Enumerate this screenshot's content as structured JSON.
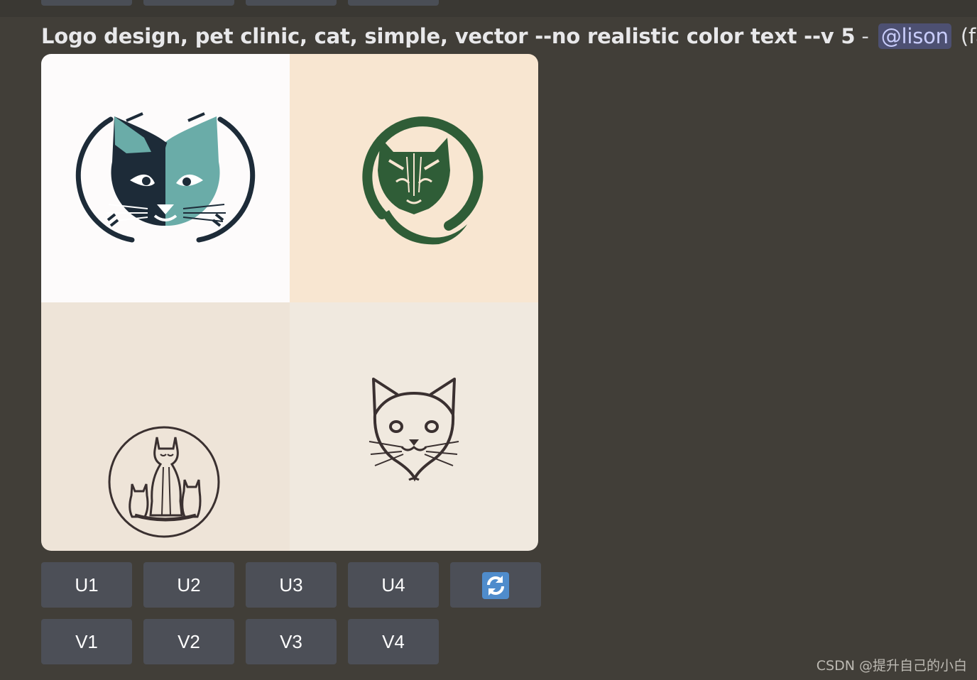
{
  "message": {
    "prompt": "Logo design, pet clinic, cat, simple, vector --no realistic color text --v 5",
    "separator": "-",
    "mention": "@lison",
    "speed": "(fast)"
  },
  "image_grid": {
    "tiles": [
      {
        "icon": "teal-cat-face-logo"
      },
      {
        "icon": "green-circle-cat-logo"
      },
      {
        "icon": "cat-family-circle-logo"
      },
      {
        "icon": "line-cat-face-logo"
      }
    ]
  },
  "buttons": {
    "upscale": [
      "U1",
      "U2",
      "U3",
      "U4"
    ],
    "variation": [
      "V1",
      "V2",
      "V3",
      "V4"
    ],
    "reroll_icon": "arrows-counterclockwise-icon"
  },
  "colors": {
    "background": "#413e38",
    "button": "#4c4f57",
    "mention_bg": "#4d5072",
    "mention_text": "#c9cdfb",
    "reroll_blue": "#4f8ccc"
  },
  "watermark": "CSDN @提升自己的小白"
}
